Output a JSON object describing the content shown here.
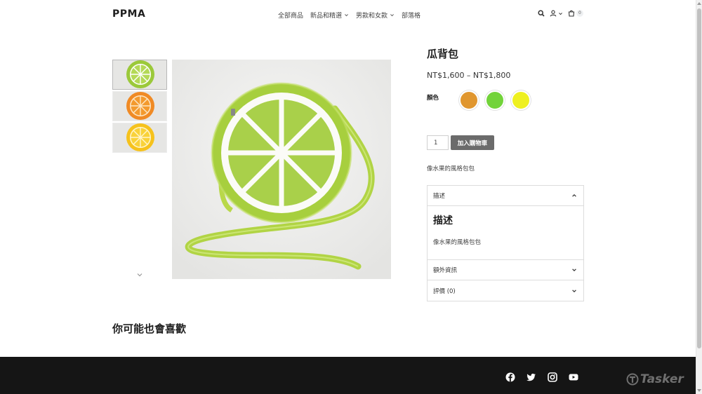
{
  "header": {
    "logo": "PPMA",
    "nav": [
      {
        "label": "全部商品",
        "has_dropdown": false
      },
      {
        "label": "新品和精選",
        "has_dropdown": true
      },
      {
        "label": "男款和女款",
        "has_dropdown": true
      },
      {
        "label": "部落格",
        "has_dropdown": false
      }
    ],
    "cart_count": "0",
    "icons": [
      "search-icon",
      "user-icon",
      "chevron-down-icon",
      "cart-icon"
    ]
  },
  "gallery": {
    "thumbnails": [
      {
        "label": "lime",
        "fruit_color": "#9bc93a"
      },
      {
        "label": "orange",
        "fruit_color": "#f08a24"
      },
      {
        "label": "lemon",
        "fruit_color": "#f6c21c"
      }
    ],
    "main_color": "#a6cc3f"
  },
  "product": {
    "title": "瓜背包",
    "price": "NT$1,600 – NT$1,800",
    "color_label": "顏色",
    "swatches": [
      {
        "name": "orange",
        "color": "#e0962e"
      },
      {
        "name": "green",
        "color": "#72d33a"
      },
      {
        "name": "yellow",
        "color": "#eef020"
      }
    ],
    "quantity": "1",
    "add_to_cart": "加入購物車",
    "short_description": "像水果的風格包包"
  },
  "accordion": {
    "description_tab": "描述",
    "description_heading": "描述",
    "description_text": "像水果的風格包包",
    "additional_info_tab": "額外資訊",
    "reviews_tab": "評價 (0)"
  },
  "related": {
    "heading": "你可能也會喜歡"
  },
  "footer": {
    "socials": [
      "facebook-icon",
      "twitter-icon",
      "instagram-icon",
      "youtube-icon"
    ],
    "watermark": "Tasker"
  }
}
